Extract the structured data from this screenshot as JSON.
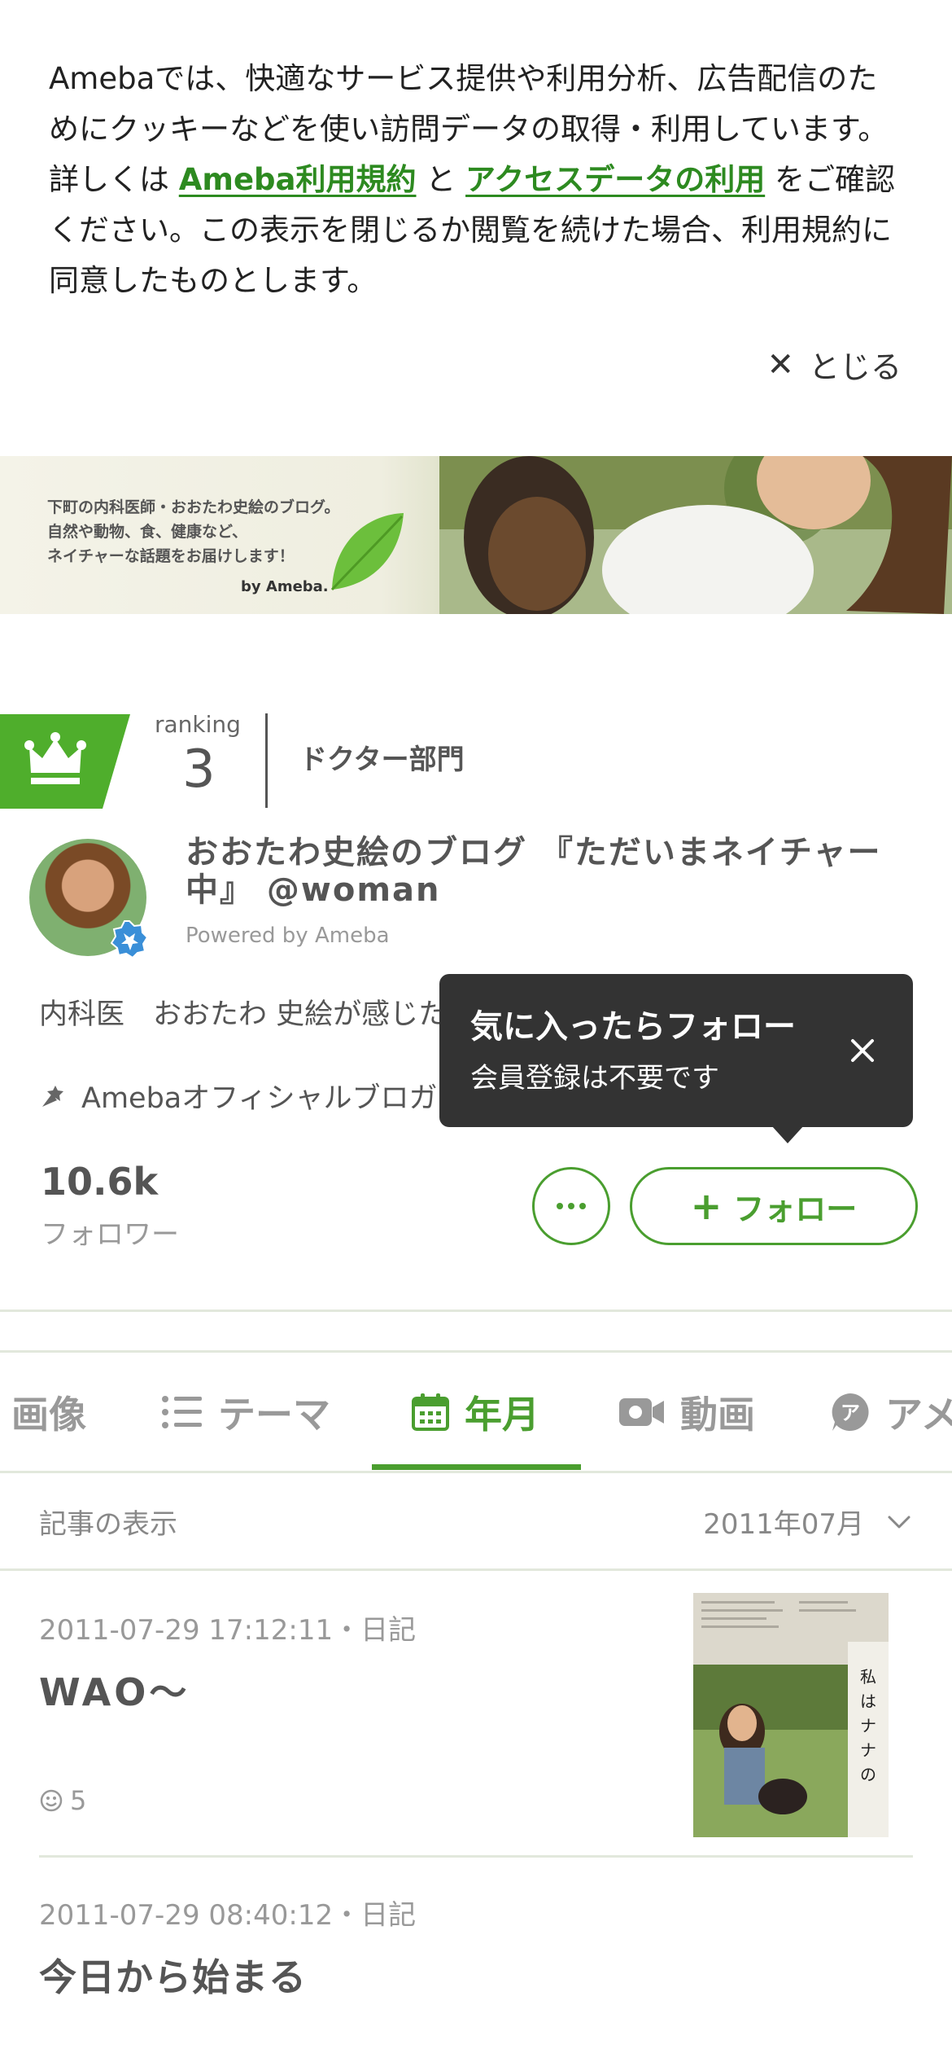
{
  "cookie_notice": {
    "text_1": "Amebaでは、快適なサービス提供や利用分析、広告配信のためにクッキーなどを使い訪問データの取得・利用しています。詳しくは ",
    "link_terms": "Ameba利用規約",
    "text_2": " と ",
    "link_access_data": "アクセスデータの利用",
    "text_3": " をご確認ください。この表示を閉じるか閲覧を続けた場合、利用規約に同意したものとします。",
    "close_label": "とじる"
  },
  "banner": {
    "tagline_1": "下町の内科医師・おおたわ史絵のブログ。",
    "tagline_2": "自然や動物、食、健康など、",
    "tagline_3": "ネイチャーな話題をお届けします！",
    "by_label": "by Ameba."
  },
  "ranking": {
    "label": "ranking",
    "number": "3",
    "category": "ドクター部門"
  },
  "profile": {
    "blog_title": "おおたわ史絵のブログ 『ただいまネイチャー中』 @woman",
    "powered_by": "Powered by Ameba",
    "bio": "内科医　おおたわ 史絵が感じた",
    "official_label": "Amebaオフィシャルブロガー"
  },
  "tooltip": {
    "title": "気に入ったらフォロー",
    "subtitle": "会員登録は不要です"
  },
  "followers": {
    "count": "10.6k",
    "label": "フォロワー"
  },
  "follow_button": {
    "label": "フォロー"
  },
  "tabs": [
    {
      "label": "画像",
      "icon": "image-icon",
      "active": false
    },
    {
      "label": "テーマ",
      "icon": "list-icon",
      "active": false
    },
    {
      "label": "年月",
      "icon": "calendar-icon",
      "active": true
    },
    {
      "label": "動画",
      "icon": "video-icon",
      "active": false
    },
    {
      "label": "アメ",
      "icon": "ameba-icon",
      "active": false
    }
  ],
  "filter": {
    "label": "記事の表示",
    "value": "2011年07月"
  },
  "articles": [
    {
      "meta": "2011-07-29 17:12:11・日記",
      "title": "WAO〜",
      "likes": "5"
    },
    {
      "meta": "2011-07-29 08:40:12・日記",
      "title": "今日から始まる"
    }
  ],
  "colors": {
    "accent": "#4a9e2f",
    "link": "#2d8a20",
    "tooltip_bg": "#333333"
  }
}
